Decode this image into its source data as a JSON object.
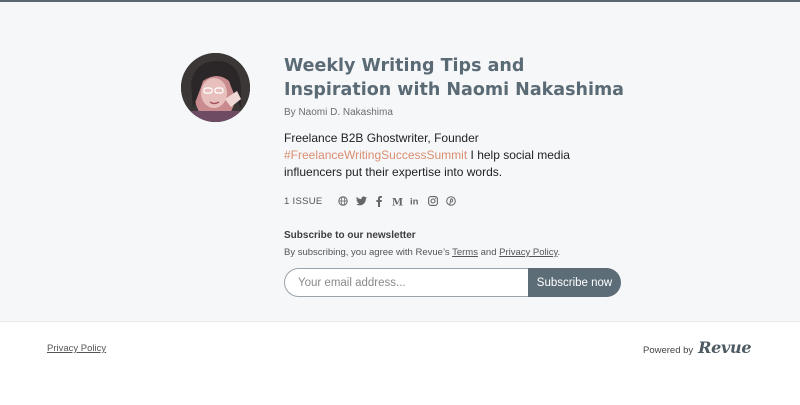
{
  "colors": {
    "accent": "#5b6b75",
    "button_bg": "#5d6d78",
    "hashtag": "#d98e70",
    "hero_bg": "#f6f7f9"
  },
  "profile": {
    "title": "Weekly Writing Tips and Inspiration with Naomi Nakashima",
    "byline": "By Naomi D. Nakashima",
    "description_prefix": "Freelance B2B Ghostwriter, Founder ",
    "hashtag": "#FreelanceWritingSuccessSummit",
    "description_suffix": " I help social media influencers put their expertise into words.",
    "issues": "1 ISSUE",
    "social_icons": [
      "website-icon",
      "twitter-icon",
      "facebook-icon",
      "medium-icon",
      "linkedin-icon",
      "instagram-icon",
      "pinterest-icon"
    ]
  },
  "subscribe": {
    "heading": "Subscribe to our newsletter",
    "consent_prefix": "By subscribing, you agree with Revue’s ",
    "terms_link": "Terms",
    "consent_and": " and ",
    "privacy_link": "Privacy Policy",
    "consent_suffix": ".",
    "email_placeholder": "Your email address...",
    "button_label": "Subscribe now"
  },
  "footer": {
    "privacy_link": "Privacy Policy",
    "powered_by": "Powered by",
    "brand": "Revue"
  }
}
